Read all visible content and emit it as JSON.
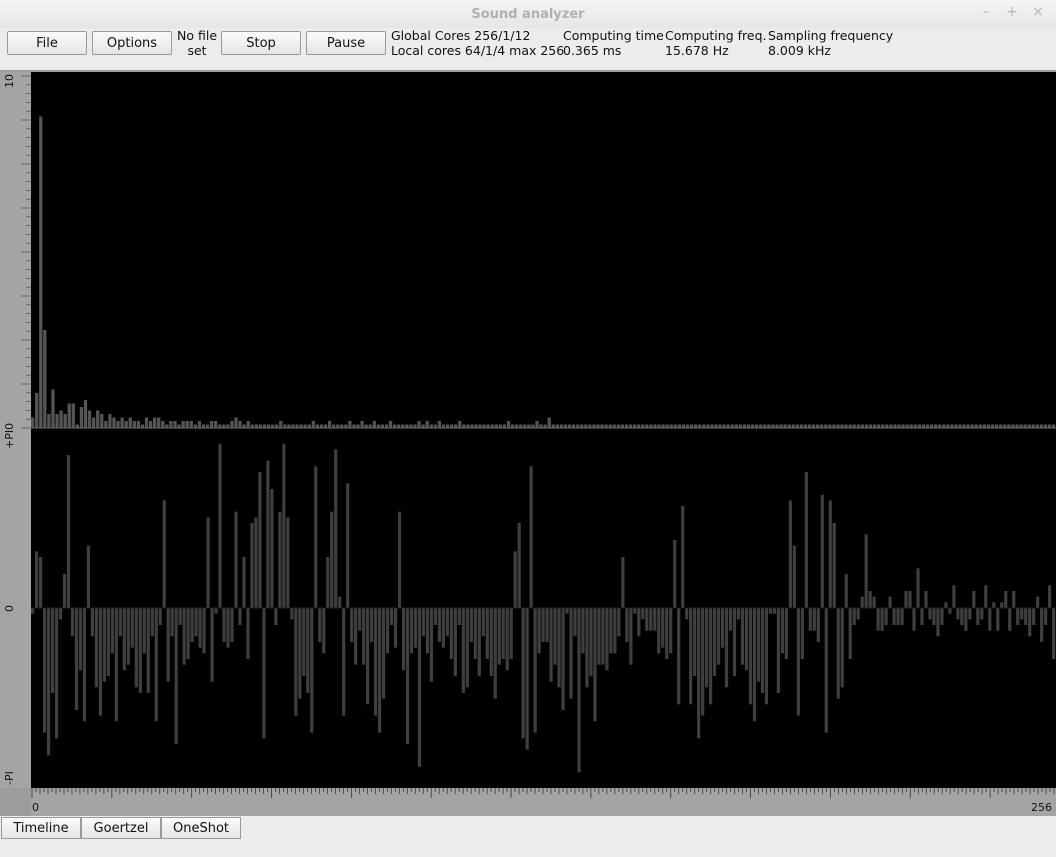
{
  "window": {
    "title": "Sound analyzer",
    "controls": [
      "–",
      "+",
      "×"
    ]
  },
  "toolbar": {
    "file_label": "File",
    "options_label": "Options",
    "file_status_line1": "No file",
    "file_status_line2": "set",
    "stop_label": "Stop",
    "pause_label": "Pause",
    "global_cores": "Global Cores 256/1/12",
    "local_cores": "Local cores 64/1/4 max 256",
    "computing_time_label": "Computing time",
    "computing_time_value": "0.365 ms",
    "computing_freq_label": "Computing freq.",
    "computing_freq_value": "15.678 Hz",
    "sampling_freq_label": "Sampling frequency",
    "sampling_freq_value": "8.009 kHz"
  },
  "plot": {
    "y_top_label": "10",
    "y_mid_label": "+PI0",
    "y_zero_label": "0",
    "y_bottom_label": "-PI",
    "x_min_label": "0",
    "x_max_label": "256"
  },
  "tabs": {
    "timeline": "Timeline",
    "goertzel": "Goertzel",
    "oneshot": "OneShot"
  },
  "chart_data": [
    {
      "type": "bar",
      "description_series": "magnitude",
      "xlim": [
        0,
        256
      ],
      "ylim": [
        0,
        10
      ],
      "values": [
        0.3,
        1.0,
        8.9,
        2.8,
        0.4,
        1.1,
        0.4,
        0.5,
        0.4,
        0.7,
        0.7,
        0.1,
        0.6,
        0.8,
        0.5,
        0.3,
        0.5,
        0.4,
        0.2,
        0.4,
        0.3,
        0.2,
        0.3,
        0.2,
        0.3,
        0.2,
        0.2,
        0.1,
        0.3,
        0.2,
        0.3,
        0.3,
        0.2,
        0.1,
        0.2,
        0.2,
        0.1,
        0.2,
        0.2,
        0.2,
        0.1,
        0.2,
        0.1,
        0.1,
        0.2,
        0.2,
        0.1,
        0.1,
        0.1,
        0.2,
        0.3,
        0.2,
        0.1,
        0.2,
        0.1,
        0.1,
        0.1,
        0.1,
        0.1,
        0.1,
        0.1,
        0.2,
        0.1,
        0.1,
        0.1,
        0.1,
        0.1,
        0.1,
        0.1,
        0.2,
        0.1,
        0.1,
        0.1,
        0.2,
        0.1,
        0.1,
        0.1,
        0.1,
        0.2,
        0.1,
        0.1,
        0.2,
        0.1,
        0.1,
        0.2,
        0.1,
        0.1,
        0.1,
        0.2,
        0.1,
        0.1,
        0.1,
        0.1,
        0.1,
        0.1,
        0.2,
        0.1,
        0.2,
        0.1,
        0.1,
        0.2,
        0.1,
        0.1,
        0.1,
        0.1,
        0.2,
        0.1,
        0.1,
        0.1,
        0.1,
        0.1,
        0.1,
        0.1,
        0.1,
        0.1,
        0.1,
        0.1,
        0.2,
        0.1,
        0.1,
        0.1,
        0.1,
        0.1,
        0.1,
        0.2,
        0.1,
        0.1,
        0.3,
        0.1,
        0.1,
        0.1,
        0.1,
        0.1,
        0.1,
        0.1,
        0.1,
        0.1,
        0.1,
        0.1,
        0.1,
        0.1,
        0.1,
        0.1,
        0.1,
        0.1,
        0.1,
        0.1,
        0.1,
        0.1,
        0.1,
        0.1,
        0.1,
        0.1,
        0.1,
        0.1,
        0.1,
        0.1,
        0.1,
        0.1,
        0.1,
        0.1,
        0.1,
        0.1,
        0.1,
        0.1,
        0.1,
        0.1,
        0.1,
        0.1,
        0.1,
        0.1,
        0.1,
        0.1,
        0.1,
        0.1,
        0.1,
        0.1,
        0.1,
        0.1,
        0.1,
        0.1,
        0.1,
        0.1,
        0.1,
        0.1,
        0.1,
        0.1,
        0.1,
        0.1,
        0.1,
        0.1,
        0.1,
        0.1,
        0.1,
        0.1,
        0.1,
        0.1,
        0.1,
        0.1,
        0.1,
        0.1,
        0.1,
        0.1,
        0.1,
        0.1,
        0.1,
        0.1,
        0.1,
        0.1,
        0.1,
        0.1,
        0.1,
        0.1,
        0.1,
        0.1,
        0.1,
        0.1,
        0.1,
        0.1,
        0.1,
        0.1,
        0.1,
        0.1,
        0.1,
        0.1,
        0.1,
        0.1,
        0.1,
        0.1,
        0.1,
        0.1,
        0.1,
        0.1,
        0.1,
        0.1,
        0.1,
        0.1,
        0.1,
        0.1,
        0.1,
        0.1,
        0.1,
        0.1,
        0.1,
        0.1,
        0.1,
        0.1,
        0.1,
        0.1,
        0.1,
        0.1,
        0.1
      ]
    },
    {
      "type": "bar",
      "description_series": "phase",
      "xlim": [
        0,
        256
      ],
      "ylim": [
        -3.14159,
        3.14159
      ],
      "values": [
        -0.1,
        1.0,
        0.9,
        -2.2,
        -2.6,
        -1.5,
        -2.3,
        -0.2,
        0.6,
        2.7,
        -0.5,
        -1.8,
        -1.1,
        -2.0,
        1.1,
        -0.5,
        -1.4,
        -1.9,
        -1.3,
        -1.2,
        -0.8,
        -2.0,
        -0.5,
        -1.1,
        -1.0,
        -0.7,
        -1.4,
        -1.5,
        -0.8,
        -1.5,
        -0.5,
        -2.0,
        -0.3,
        1.9,
        -1.3,
        -0.5,
        -2.4,
        -0.3,
        -1.0,
        -0.9,
        -0.6,
        -0.5,
        -0.7,
        -0.8,
        1.6,
        -1.3,
        -0.1,
        2.9,
        -0.6,
        -0.7,
        -0.6,
        1.7,
        -0.3,
        0.9,
        -0.9,
        1.5,
        1.6,
        2.4,
        -2.3,
        2.6,
        2.1,
        -0.3,
        1.7,
        2.9,
        1.6,
        -0.2,
        -1.9,
        -1.6,
        -1.2,
        -1.5,
        -2.2,
        2.5,
        -0.6,
        -0.8,
        0.9,
        1.7,
        2.8,
        0.2,
        -1.9,
        2.2,
        -0.6,
        -1.0,
        -0.4,
        -1.0,
        -1.7,
        -0.6,
        -1.9,
        -2.2,
        -1.6,
        -0.8,
        -0.3,
        -0.7,
        1.7,
        -1.1,
        -2.4,
        -0.8,
        -0.7,
        -2.8,
        -0.5,
        -0.8,
        -1.3,
        -0.3,
        -0.6,
        -0.7,
        -0.5,
        -0.9,
        -1.2,
        -0.3,
        -1.5,
        -1.4,
        -0.6,
        -0.9,
        -1.2,
        -0.5,
        -0.9,
        -1.2,
        -1.6,
        -1.0,
        -0.9,
        -1.1,
        -0.9,
        1.0,
        1.5,
        -2.3,
        -2.5,
        2.5,
        -2.2,
        -0.8,
        -0.6,
        -0.6,
        -1.3,
        -1.0,
        -1.4,
        -1.8,
        -0.1,
        -1.6,
        -0.5,
        -2.9,
        -0.8,
        -1.4,
        -1.2,
        -2.0,
        -1.0,
        -1.0,
        -1.1,
        -0.8,
        -0.8,
        -0.5,
        0.9,
        -0.6,
        -1.0,
        -0.1,
        -0.5,
        -0.2,
        -0.4,
        -0.4,
        -0.4,
        -0.8,
        -0.7,
        -0.9,
        -0.8,
        1.2,
        -1.7,
        1.8,
        -0.2,
        -1.7,
        -1.2,
        -2.3,
        -1.9,
        -1.4,
        -1.7,
        -1.2,
        -1.0,
        -0.7,
        -1.4,
        -0.4,
        -1.2,
        -0.2,
        -1.0,
        -1.1,
        -1.7,
        -2.0,
        -1.3,
        -1.5,
        -1.7,
        -0.1,
        -0.1,
        -1.5,
        -0.8,
        -0.9,
        1.9,
        1.1,
        -1.9,
        -0.9,
        2.4,
        -0.4,
        -0.4,
        -0.6,
        2.0,
        -2.2,
        1.9,
        1.5,
        -1.6,
        -1.4,
        0.6,
        -0.9,
        -0.3,
        -0.2,
        0.2,
        1.3,
        0.3,
        0.2,
        -0.4,
        -0.4,
        -0.3,
        0.2,
        -0.3,
        -0.3,
        -0.3,
        0.3,
        0.3,
        -0.4,
        0.7,
        -0.3,
        0.3,
        -0.2,
        -0.3,
        -0.5,
        -0.3,
        0.1,
        -0.1,
        0.4,
        -0.2,
        -0.3,
        -0.4,
        -0.2,
        0.3,
        -0.3,
        -0.2,
        0.4,
        -0.4,
        0.1,
        -0.4,
        0.1,
        0.3,
        -0.4,
        0.3,
        -0.3,
        -0.2,
        -0.3,
        -0.5,
        -0.3,
        0.2,
        -0.6,
        -0.3,
        0.4,
        -0.9
      ]
    }
  ]
}
